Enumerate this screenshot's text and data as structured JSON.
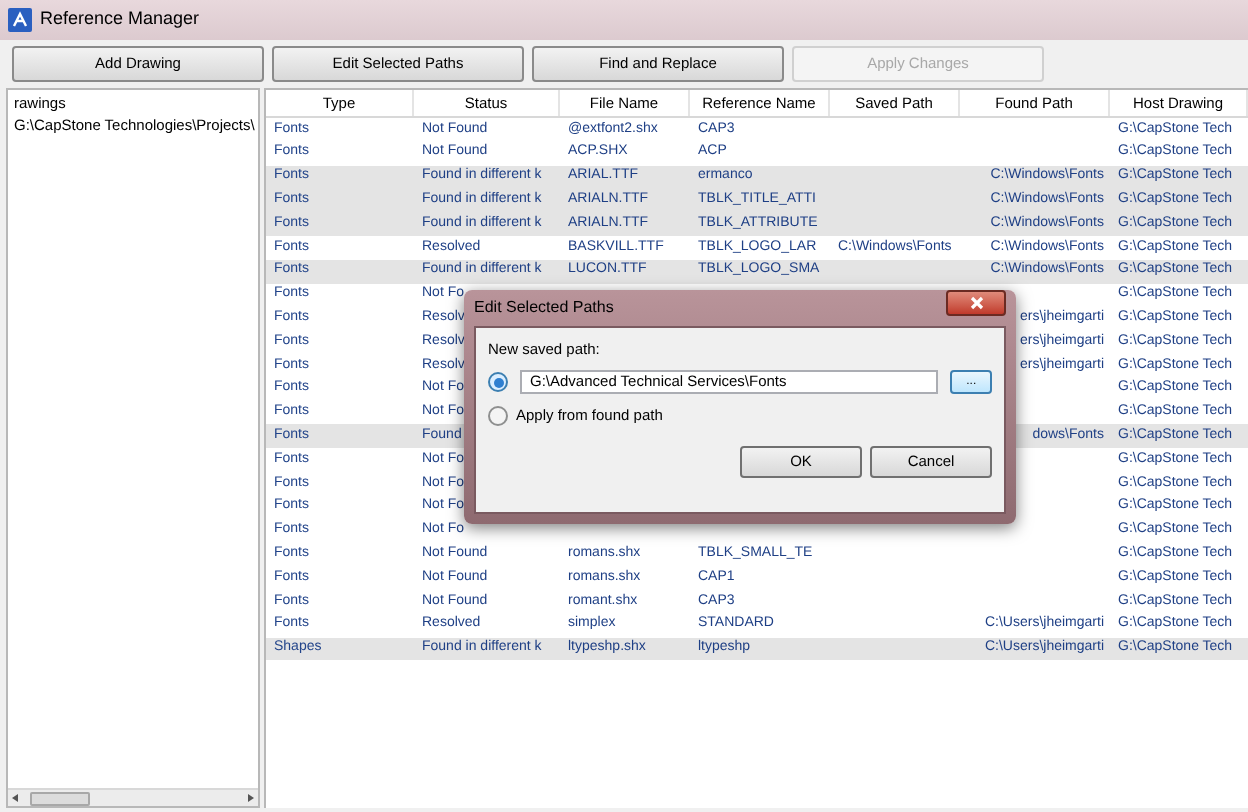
{
  "window": {
    "title": "Reference Manager"
  },
  "toolbar": [
    {
      "label": "Add Drawing",
      "disabled": false
    },
    {
      "label": "Edit Selected Paths",
      "disabled": false
    },
    {
      "label": "Find and Replace",
      "disabled": false
    },
    {
      "label": "Apply Changes",
      "disabled": true
    }
  ],
  "tree": {
    "header": "rawings",
    "items": [
      "G:\\CapStone Technologies\\Projects\\"
    ]
  },
  "table": {
    "columns": [
      "Type",
      "Status",
      "File Name",
      "Reference Name",
      "Saved Path",
      "Found Path",
      "Host Drawing"
    ],
    "rows": [
      {
        "selected": false,
        "cells": [
          "Fonts",
          "Not Found",
          "@extfont2.shx",
          "CAP3",
          "",
          "",
          "G:\\CapStone Tech"
        ]
      },
      {
        "selected": false,
        "cells": [
          "Fonts",
          "Not Found",
          "ACP.SHX",
          "ACP",
          "",
          "",
          "G:\\CapStone Tech"
        ]
      },
      {
        "selected": true,
        "cells": [
          "Fonts",
          "Found in different k",
          "ARIAL.TTF",
          "ermanco",
          "",
          "C:\\Windows\\Fonts",
          "G:\\CapStone Tech"
        ]
      },
      {
        "selected": true,
        "cells": [
          "Fonts",
          "Found in different k",
          "ARIALN.TTF",
          "TBLK_TITLE_ATTI",
          "",
          "C:\\Windows\\Fonts",
          "G:\\CapStone Tech"
        ]
      },
      {
        "selected": true,
        "cells": [
          "Fonts",
          "Found in different k",
          "ARIALN.TTF",
          "TBLK_ATTRIBUTE",
          "",
          "C:\\Windows\\Fonts",
          "G:\\CapStone Tech"
        ]
      },
      {
        "selected": false,
        "cells": [
          "Fonts",
          "Resolved",
          "BASKVILL.TTF",
          "TBLK_LOGO_LAR",
          "C:\\Windows\\Fonts",
          "C:\\Windows\\Fonts",
          "G:\\CapStone Tech"
        ]
      },
      {
        "selected": true,
        "cells": [
          "Fonts",
          "Found in different k",
          "LUCON.TTF",
          "TBLK_LOGO_SMA",
          "",
          "C:\\Windows\\Fonts",
          "G:\\CapStone Tech"
        ]
      },
      {
        "selected": false,
        "cells": [
          "Fonts",
          "Not Fo",
          "",
          "",
          "",
          "",
          "G:\\CapStone Tech"
        ]
      },
      {
        "selected": false,
        "cells": [
          "Fonts",
          "Resolv",
          "",
          "",
          "",
          "ers\\jheimgarti",
          "G:\\CapStone Tech"
        ]
      },
      {
        "selected": false,
        "cells": [
          "Fonts",
          "Resolv",
          "",
          "",
          "",
          "ers\\jheimgarti",
          "G:\\CapStone Tech"
        ]
      },
      {
        "selected": false,
        "cells": [
          "Fonts",
          "Resolv",
          "",
          "",
          "",
          "ers\\jheimgarti",
          "G:\\CapStone Tech"
        ]
      },
      {
        "selected": false,
        "cells": [
          "Fonts",
          "Not Fo",
          "",
          "",
          "",
          "",
          "G:\\CapStone Tech"
        ]
      },
      {
        "selected": false,
        "cells": [
          "Fonts",
          "Not Fo",
          "",
          "",
          "",
          "",
          "G:\\CapStone Tech"
        ]
      },
      {
        "selected": true,
        "cells": [
          "Fonts",
          "Found",
          "",
          "",
          "",
          "dows\\Fonts",
          "G:\\CapStone Tech"
        ]
      },
      {
        "selected": false,
        "cells": [
          "Fonts",
          "Not Fo",
          "",
          "",
          "",
          "",
          "G:\\CapStone Tech"
        ]
      },
      {
        "selected": false,
        "cells": [
          "Fonts",
          "Not Fo",
          "",
          "",
          "",
          "",
          "G:\\CapStone Tech"
        ]
      },
      {
        "selected": false,
        "cells": [
          "Fonts",
          "Not Fo",
          "",
          "",
          "",
          "",
          "G:\\CapStone Tech"
        ]
      },
      {
        "selected": false,
        "cells": [
          "Fonts",
          "Not Fo",
          "",
          "",
          "",
          "",
          "G:\\CapStone Tech"
        ]
      },
      {
        "selected": false,
        "cells": [
          "Fonts",
          "Not Found",
          "romans.shx",
          "TBLK_SMALL_TE",
          "",
          "",
          "G:\\CapStone Tech"
        ]
      },
      {
        "selected": false,
        "cells": [
          "Fonts",
          "Not Found",
          "romans.shx",
          "CAP1",
          "",
          "",
          "G:\\CapStone Tech"
        ]
      },
      {
        "selected": false,
        "cells": [
          "Fonts",
          "Not Found",
          "romant.shx",
          "CAP3",
          "",
          "",
          "G:\\CapStone Tech"
        ]
      },
      {
        "selected": false,
        "cells": [
          "Fonts",
          "Resolved",
          "simplex",
          "STANDARD",
          "",
          "C:\\Users\\jheimgarti",
          "G:\\CapStone Tech"
        ]
      },
      {
        "selected": true,
        "cells": [
          "Shapes",
          "Found in different k",
          "ltypeshp.shx",
          "ltypeshp",
          "",
          "C:\\Users\\jheimgarti",
          "G:\\CapStone Tech"
        ]
      }
    ]
  },
  "dialog": {
    "title": "Edit Selected Paths",
    "label": "New saved path:",
    "options": [
      {
        "kind": "path",
        "selected": true,
        "value": "G:\\Advanced Technical Services\\Fonts",
        "browse": "..."
      },
      {
        "kind": "label",
        "selected": false,
        "label": "Apply from found path"
      }
    ],
    "buttons": [
      "OK",
      "Cancel"
    ]
  }
}
